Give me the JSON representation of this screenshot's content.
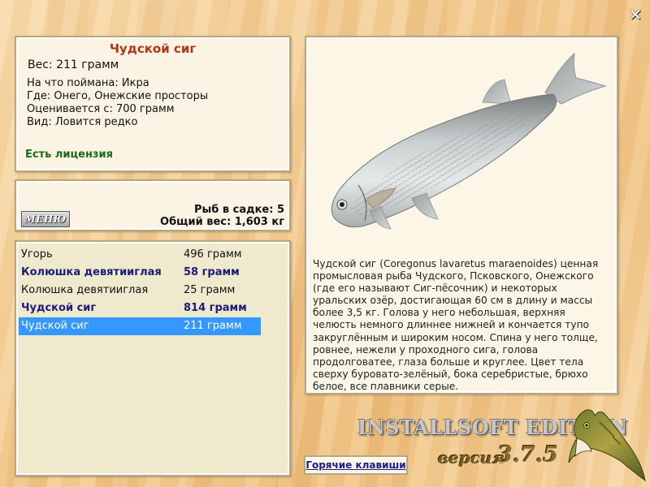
{
  "window": {
    "close_icon": "close-icon"
  },
  "info": {
    "fish_name": "Чудской сиг",
    "weight_line": "Вес: 211 грамм",
    "details": [
      "На что поймана: Икра",
      "Где: Онего, Онежские просторы",
      "Оценивается с: 700 грамм",
      "Вид: Ловится редко"
    ],
    "license": "Есть лицензия"
  },
  "stats": {
    "menu_label": "МЕНЮ",
    "fish_in_keepnet": "Рыб в садке: 5",
    "total_weight": "Общий вес: 1,603 кг"
  },
  "catch_list": [
    {
      "name": "Угорь",
      "weight": "496 грамм",
      "style": "normal"
    },
    {
      "name": "Колюшка девятииглая",
      "weight": "58 грамм",
      "style": "bold"
    },
    {
      "name": "Колюшка девятииглая",
      "weight": "25 грамм",
      "style": "normal"
    },
    {
      "name": "Чудской сиг",
      "weight": "814 грамм",
      "style": "bold"
    },
    {
      "name": "Чудской сиг",
      "weight": "211 грамм",
      "style": "selected"
    }
  ],
  "description": "Чудской сиг (Coregonus lavaretus maraenoides) ценная промысловая рыба Чудского, Псковского, Онежского (где его называют Сиг-пёсочник) и некоторых уральских озёр, достигающая 60 см в длину и массы более 3,5 кг. Голова у него небольшая, верхняя челюсть немного длиннее нижней и кончается тупо закруглённым и широким носом. Спина у него толще, ровнее, нежели у проходного сига, голова продолговатее, глаза больше и круглее. Цвет тела сверху буровато-зелёный, бока серебристые, брюхо белое, все плавники серые.",
  "footer": {
    "hotkeys_label": "Горячие клавиши",
    "edition": "INSTALLSOFT EDITION",
    "version_word": "версия",
    "version_number": "3.7.5"
  },
  "colors": {
    "title": "#b2351a",
    "license": "#1a6b19",
    "bold_row": "#1c1c78",
    "selection": "#3399ff"
  }
}
